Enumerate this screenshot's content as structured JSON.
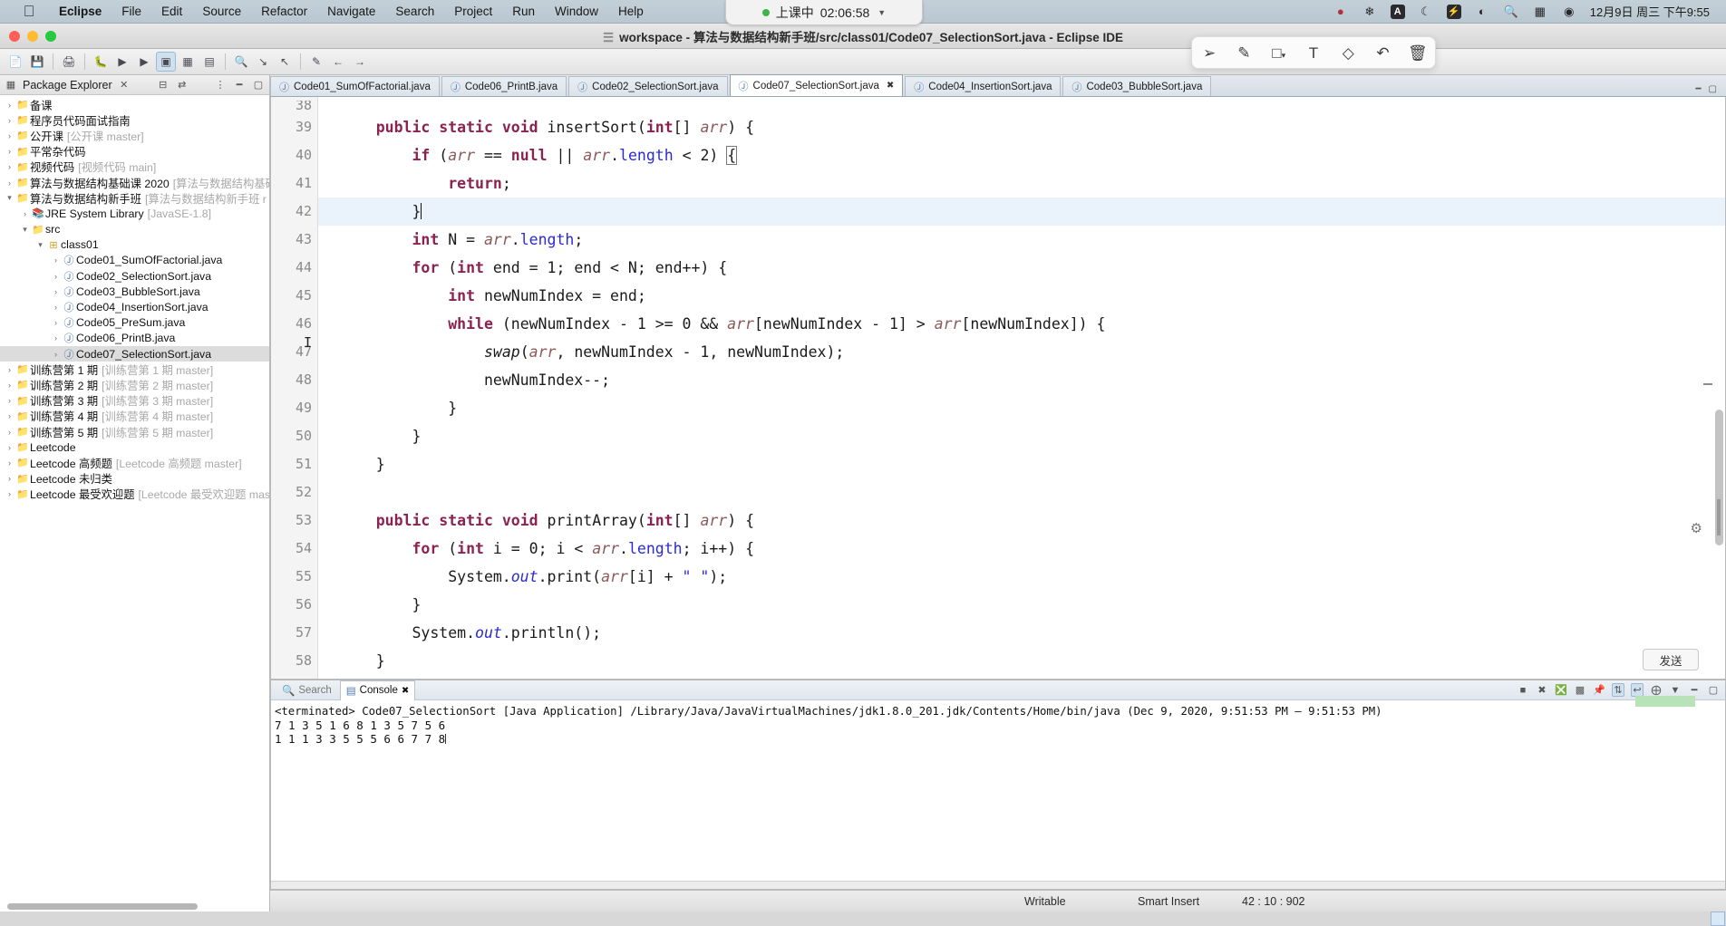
{
  "macbar": {
    "apple_icon": "apple-logo",
    "menus": [
      "Eclipse",
      "File",
      "Edit",
      "Source",
      "Refactor",
      "Navigate",
      "Search",
      "Project",
      "Run",
      "Window",
      "Help"
    ],
    "status_icons": [
      "screen-record-icon",
      "evernote-icon",
      "letter-a-icon",
      "moon-icon",
      "battery-icon",
      "wifi-icon",
      "search-icon",
      "keyboard-icon",
      "siri-icon"
    ],
    "clock": "12月9日 周三 下午9:55"
  },
  "recording": {
    "label": "上课中",
    "time": "02:06:58",
    "chevron": "chevron-down-icon"
  },
  "window": {
    "title": "workspace - 算法与数据结构新手班/src/class01/Code07_SelectionSort.java - Eclipse IDE"
  },
  "annotation_toolbar": {
    "tools": [
      "cursor-icon",
      "pen-icon",
      "shape-icon",
      "text-icon",
      "eraser-icon",
      "undo-icon",
      "trash-icon"
    ]
  },
  "sidebar": {
    "title": "Package Explorer",
    "close_glyph": "✕",
    "header_icons": [
      "collapse-all-icon",
      "link-with-editor-icon",
      "view-menu-icon",
      "minimize-icon",
      "maximize-icon"
    ],
    "items": [
      {
        "indent": 0,
        "arrow": "closed",
        "icon": "project-icon",
        "label": "备课",
        "sub": ""
      },
      {
        "indent": 0,
        "arrow": "closed",
        "icon": "project-icon",
        "label": "程序员代码面试指南",
        "sub": ""
      },
      {
        "indent": 0,
        "arrow": "closed",
        "icon": "project-icon",
        "label": "公开课",
        "sub": "[公开课 master]"
      },
      {
        "indent": 0,
        "arrow": "closed",
        "icon": "project-icon",
        "label": "平常杂代码",
        "sub": ""
      },
      {
        "indent": 0,
        "arrow": "closed",
        "icon": "project-icon",
        "label": "视频代码",
        "sub": "[视频代码 main]"
      },
      {
        "indent": 0,
        "arrow": "closed",
        "icon": "project-icon",
        "label": "算法与数据结构基础课 2020",
        "sub": "[算法与数据结构基础"
      },
      {
        "indent": 0,
        "arrow": "open",
        "icon": "project-icon",
        "label": "算法与数据结构新手班",
        "sub": "[算法与数据结构新手班 r"
      },
      {
        "indent": 1,
        "arrow": "closed",
        "icon": "library-icon",
        "label": "JRE System Library",
        "sub": "[JavaSE-1.8]"
      },
      {
        "indent": 1,
        "arrow": "open",
        "icon": "source-folder-icon",
        "label": "src",
        "sub": ""
      },
      {
        "indent": 2,
        "arrow": "open",
        "icon": "package-icon",
        "label": "class01",
        "sub": ""
      },
      {
        "indent": 3,
        "arrow": "closed",
        "icon": "java-file-icon",
        "label": "Code01_SumOfFactorial.java",
        "sub": ""
      },
      {
        "indent": 3,
        "arrow": "closed",
        "icon": "java-file-icon",
        "label": "Code02_SelectionSort.java",
        "sub": ""
      },
      {
        "indent": 3,
        "arrow": "closed",
        "icon": "java-file-icon",
        "label": "Code03_BubbleSort.java",
        "sub": ""
      },
      {
        "indent": 3,
        "arrow": "closed",
        "icon": "java-file-icon",
        "label": "Code04_InsertionSort.java",
        "sub": ""
      },
      {
        "indent": 3,
        "arrow": "closed",
        "icon": "java-file-icon",
        "label": "Code05_PreSum.java",
        "sub": ""
      },
      {
        "indent": 3,
        "arrow": "closed",
        "icon": "java-file-icon",
        "label": "Code06_PrintB.java",
        "sub": ""
      },
      {
        "indent": 3,
        "arrow": "closed",
        "icon": "java-file-icon",
        "label": "Code07_SelectionSort.java",
        "sub": "",
        "selected": true
      },
      {
        "indent": 0,
        "arrow": "closed",
        "icon": "project-icon",
        "label": "训练营第 1 期",
        "sub": "[训练营第 1 期 master]"
      },
      {
        "indent": 0,
        "arrow": "closed",
        "icon": "project-icon",
        "label": "训练营第 2 期",
        "sub": "[训练营第 2 期 master]"
      },
      {
        "indent": 0,
        "arrow": "closed",
        "icon": "project-icon",
        "label": "训练营第 3 期",
        "sub": "[训练营第 3 期 master]"
      },
      {
        "indent": 0,
        "arrow": "closed",
        "icon": "project-icon",
        "label": "训练营第 4 期",
        "sub": "[训练营第 4 期 master]"
      },
      {
        "indent": 0,
        "arrow": "closed",
        "icon": "project-icon",
        "label": "训练营第 5 期",
        "sub": "[训练营第 5 期 master]"
      },
      {
        "indent": 0,
        "arrow": "closed",
        "icon": "project-icon",
        "label": "Leetcode",
        "sub": ""
      },
      {
        "indent": 0,
        "arrow": "closed",
        "icon": "project-icon",
        "label": "Leetcode 高频题",
        "sub": "[Leetcode 高频题 master]"
      },
      {
        "indent": 0,
        "arrow": "closed",
        "icon": "project-icon",
        "label": "Leetcode 未归类",
        "sub": ""
      },
      {
        "indent": 0,
        "arrow": "closed",
        "icon": "project-icon",
        "label": "Leetcode 最受欢迎题",
        "sub": "[Leetcode 最受欢迎题 mast"
      }
    ]
  },
  "editor": {
    "tabs": [
      {
        "label": "Code01_SumOfFactorial.java",
        "active": false
      },
      {
        "label": "Code06_PrintB.java",
        "active": false
      },
      {
        "label": "Code02_SelectionSort.java",
        "active": false
      },
      {
        "label": "Code07_SelectionSort.java",
        "active": true
      },
      {
        "label": "Code04_InsertionSort.java",
        "active": false
      },
      {
        "label": "Code03_BubbleSort.java",
        "active": false
      }
    ],
    "first_partial_line": "38",
    "lines": [
      {
        "no": "39",
        "fold": true,
        "html": "    <span class=\"kw\">public</span> <span class=\"kw\">static</span> <span class=\"kw\">void</span> insertSort(<span class=\"kw\">int</span>[] <span class=\"par\">arr</span>) {"
      },
      {
        "no": "40",
        "fold": false,
        "html": "        <span class=\"kw\">if</span> (<span class=\"par\">arr</span> == <span class=\"kw\">null</span> || <span class=\"par\">arr</span>.<span class=\"fld\">length</span> &lt; 2) <span class=\"bracketbox\">{</span>"
      },
      {
        "no": "41",
        "fold": false,
        "html": "            <span class=\"kw\">return</span>;"
      },
      {
        "no": "42",
        "fold": false,
        "hl": true,
        "html": "        }<span class=\"caret\"></span>"
      },
      {
        "no": "43",
        "fold": false,
        "html": "        <span class=\"kw\">int</span> N = <span class=\"par\">arr</span>.<span class=\"fld\">length</span>;"
      },
      {
        "no": "44",
        "fold": false,
        "html": "        <span class=\"kw\">for</span> (<span class=\"kw\">int</span> end = 1; end &lt; N; end++) {"
      },
      {
        "no": "45",
        "fold": false,
        "html": "            <span class=\"kw\">int</span> newNumIndex = end;"
      },
      {
        "no": "46",
        "fold": false,
        "html": "            <span class=\"kw\">while</span> (newNumIndex - 1 &gt;= 0 &amp;&amp; <span class=\"par\">arr</span>[newNumIndex - 1] &gt; <span class=\"par\">arr</span>[newNumIndex]) {"
      },
      {
        "no": "47",
        "fold": false,
        "html": "                <span class=\"mth\">swap</span>(<span class=\"par\">arr</span>, newNumIndex - 1, newNumIndex);"
      },
      {
        "no": "48",
        "fold": false,
        "html": "                newNumIndex--;"
      },
      {
        "no": "49",
        "fold": false,
        "html": "            }"
      },
      {
        "no": "50",
        "fold": false,
        "html": "        }"
      },
      {
        "no": "51",
        "fold": false,
        "html": "    }"
      },
      {
        "no": "52",
        "fold": false,
        "html": ""
      },
      {
        "no": "53",
        "fold": true,
        "html": "    <span class=\"kw\">public</span> <span class=\"kw\">static</span> <span class=\"kw\">void</span> printArray(<span class=\"kw\">int</span>[] <span class=\"par\">arr</span>) {"
      },
      {
        "no": "54",
        "fold": false,
        "html": "        <span class=\"kw\">for</span> (<span class=\"kw\">int</span> i = 0; i &lt; <span class=\"par\">arr</span>.<span class=\"fld\">length</span>; i++) {"
      },
      {
        "no": "55",
        "fold": false,
        "html": "            System.<span class=\"fld\" style=\"font-style:italic\">out</span>.print(<span class=\"par\">arr</span>[i] + <span style=\"color:#2a2ad0\">\" \"</span>);"
      },
      {
        "no": "56",
        "fold": false,
        "html": "        }"
      },
      {
        "no": "57",
        "fold": false,
        "html": "        System.<span class=\"fld\" style=\"font-style:italic\">out</span>.println();"
      },
      {
        "no": "58",
        "fold": false,
        "html": "    }"
      }
    ]
  },
  "console": {
    "tabs": [
      {
        "label": "Search",
        "icon": "search-icon",
        "active": false
      },
      {
        "label": "Console",
        "icon": "console-icon",
        "active": true
      }
    ],
    "toolbar_icons": [
      "terminate-icon",
      "remove-icon",
      "remove-all-icon",
      "display-selected-icon",
      "pin-icon",
      "scroll-lock-icon",
      "word-wrap-icon",
      "new-console-icon",
      "open-console-icon",
      "minimize-icon",
      "maximize-icon"
    ],
    "header": "<terminated> Code07_SelectionSort [Java Application] /Library/Java/JavaVirtualMachines/jdk1.8.0_201.jdk/Contents/Home/bin/java  (Dec 9, 2020, 9:51:53 PM – 9:51:53 PM)",
    "output_lines": [
      "7 1 3 5 1 6 8 1 3 5 7 5 6",
      "1 1 1 3 3 5 5 5 6 6 7 7 8"
    ]
  },
  "statusbar": {
    "writable": "Writable",
    "insert_mode": "Smart Insert",
    "position": "42 : 10 : 902"
  },
  "right_rail": {
    "gear_icon": "gear-icon",
    "send_button": "发送"
  },
  "toolbar": {
    "icons": [
      "new-icon",
      "save-icon",
      "print-icon",
      "debug-icon",
      "run-icon",
      "run-last-icon",
      "coverage-icon",
      "new-java-project-icon",
      "new-class-icon",
      "search-icon",
      "next-annotation-icon",
      "prev-annotation-icon",
      "last-edit-icon",
      "back-icon",
      "forward-icon",
      "perspective-icon"
    ]
  }
}
